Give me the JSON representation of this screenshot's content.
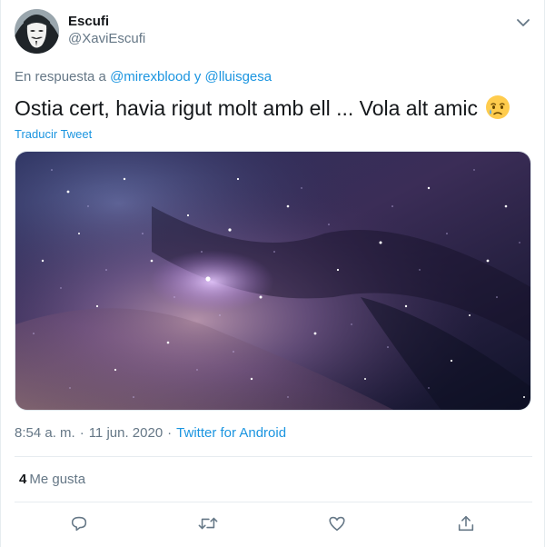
{
  "tweet": {
    "author": {
      "display_name": "Escufi",
      "handle": "@XaviEscufi",
      "avatar_icon": "anonymous-mask-avatar"
    },
    "reply_context": {
      "prefix": "En respuesta a",
      "mention_1": "@mirexblood",
      "conjunction": "y",
      "mention_2": "@lluisgesa"
    },
    "text": "Ostia cert, havia rigut molt amb ell ... Vola alt amic",
    "emoji_icon": "crying-face-emoji",
    "translate_label": "Traducir Tweet",
    "media_description_icon": "galaxy-starfield-image",
    "time": "8:54 a. m.",
    "date": "11 jun. 2020",
    "source": "Twitter for Android",
    "likes_count": "4",
    "likes_label": "Me gusta"
  },
  "actions": {
    "reply_icon": "reply-icon",
    "retweet_icon": "retweet-icon",
    "like_icon": "heart-icon",
    "share_icon": "share-icon"
  },
  "colors": {
    "link": "#1b95e0",
    "secondary_text": "#657786",
    "primary_text": "#14171a",
    "divider": "#e6ecf0"
  }
}
